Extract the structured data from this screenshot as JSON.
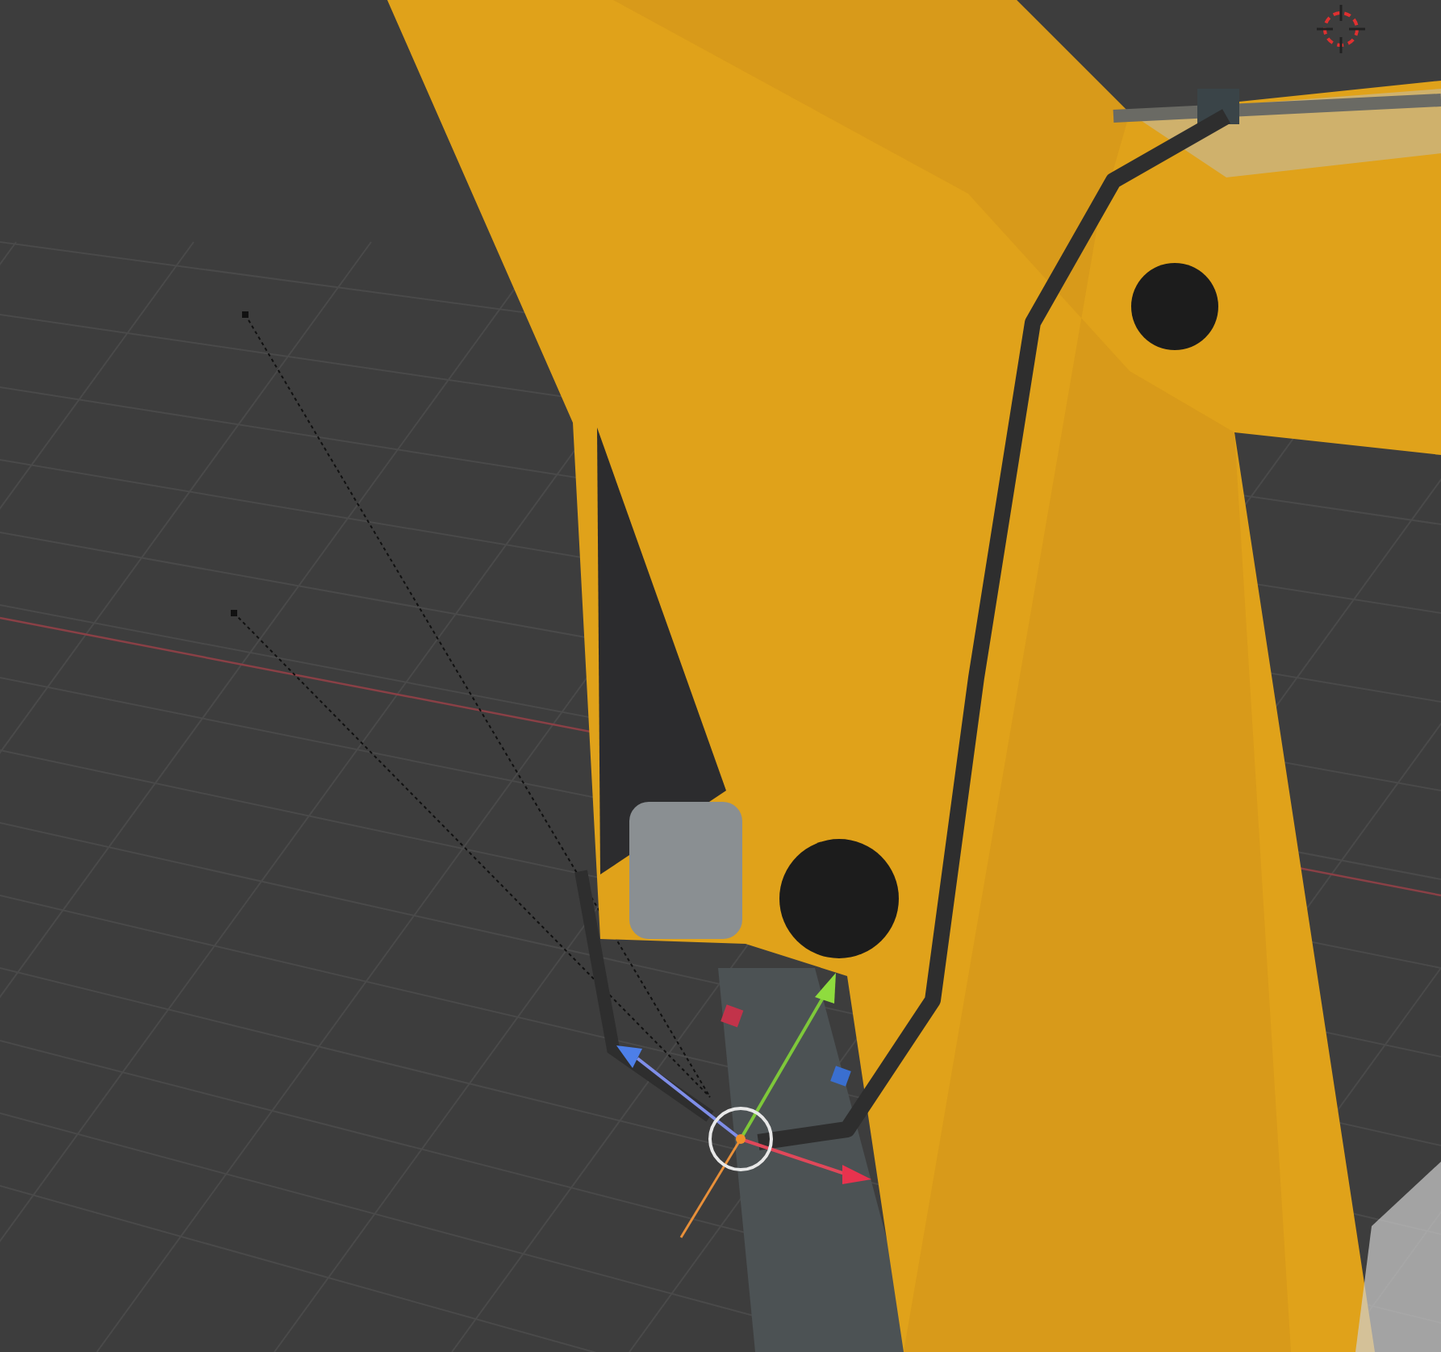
{
  "viewport": {
    "kind": "scene",
    "show_grid": true,
    "show_gizmo": true,
    "show_cursor": true
  }
}
